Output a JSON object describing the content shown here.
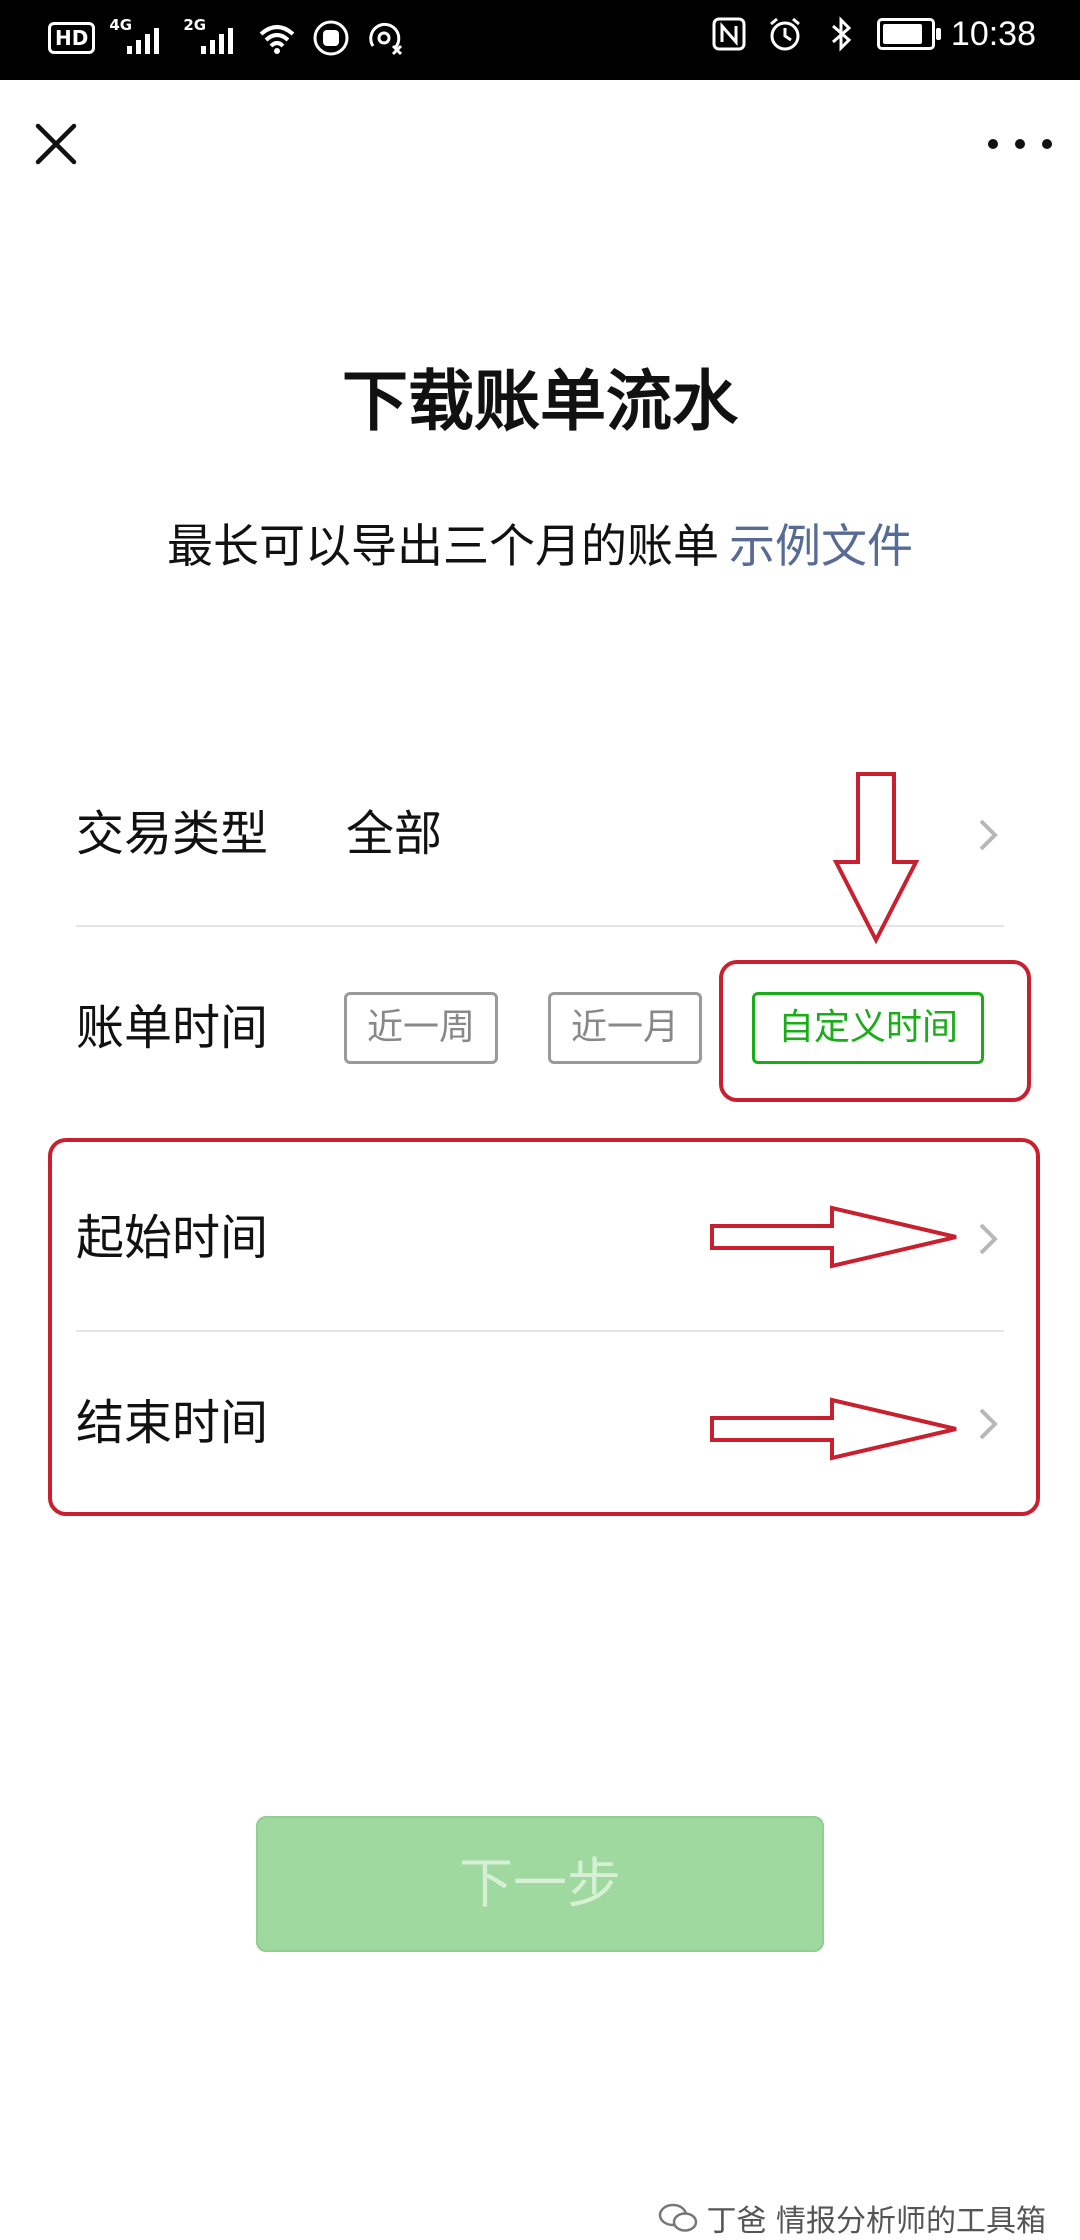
{
  "status_bar": {
    "hd_label": "HD",
    "network1_label": "4G",
    "network2_label": "2G",
    "time": "10:38",
    "battery_level": 0.85,
    "icons": [
      "hd-icon",
      "signal-4g-icon",
      "signal-2g-icon",
      "wifi-icon",
      "hand-icon",
      "hotspot-icon",
      "nfc-icon",
      "alarm-icon",
      "bluetooth-icon",
      "battery-icon"
    ]
  },
  "nav": {
    "close_icon": "close-icon",
    "more_icon": "more-icon"
  },
  "page": {
    "title": "下载账单流水",
    "subtitle": "最长可以导出三个月的账单",
    "sample_link": "示例文件"
  },
  "form": {
    "transaction_type": {
      "label": "交易类型",
      "value": "全部"
    },
    "bill_time": {
      "label": "账单时间",
      "options": [
        "近一周",
        "近一月",
        "自定义时间"
      ],
      "selected": "自定义时间"
    },
    "start_time": {
      "label": "起始时间"
    },
    "end_time": {
      "label": "结束时间"
    }
  },
  "actions": {
    "next_label": "下一步"
  },
  "watermark": {
    "text": "丁爸 情报分析师的工具箱"
  },
  "colors": {
    "accent_green": "#1aad19",
    "link_blue": "#576b95",
    "annotation_red": "#c8202f",
    "disabled_button": "#9fd99f"
  }
}
